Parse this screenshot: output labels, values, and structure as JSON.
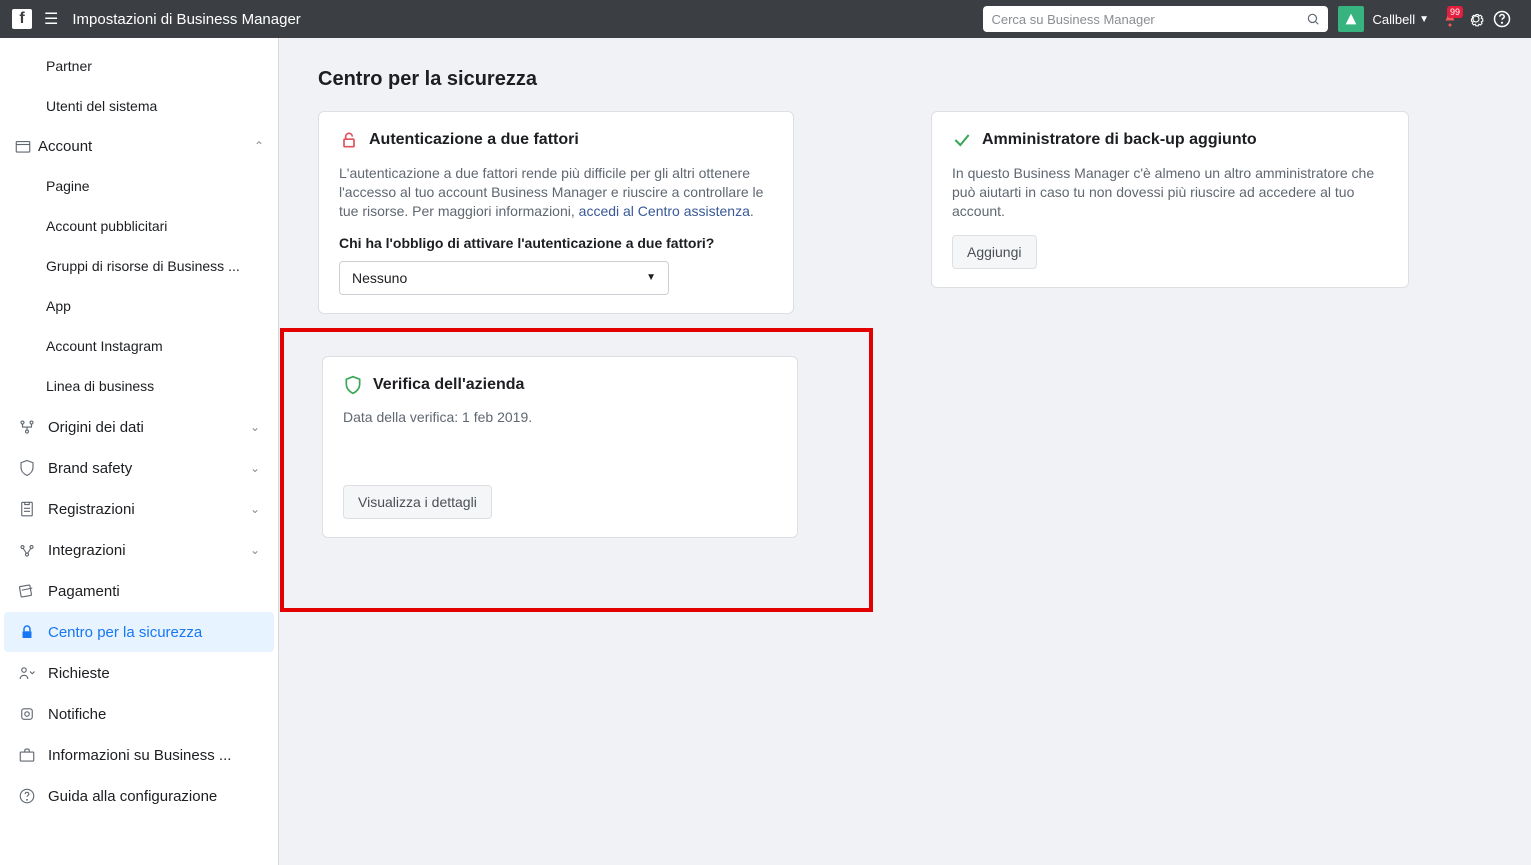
{
  "header": {
    "title": "Impostazioni di Business Manager",
    "search_placeholder": "Cerca su Business Manager",
    "brand_name": "Callbell",
    "notif_count": "99"
  },
  "sidebar": {
    "partner": "Partner",
    "utenti_sistema": "Utenti del sistema",
    "account_group": "Account",
    "pagine": "Pagine",
    "account_pubblicitari": "Account pubblicitari",
    "gruppi_risorse": "Gruppi di risorse di Business ...",
    "app": "App",
    "account_instagram": "Account Instagram",
    "linea_business": "Linea di business",
    "origini_dati": "Origini dei dati",
    "brand_safety": "Brand safety",
    "registrazioni": "Registrazioni",
    "integrazioni": "Integrazioni",
    "pagamenti": "Pagamenti",
    "centro_sicurezza": "Centro per la sicurezza",
    "richieste": "Richieste",
    "notifiche": "Notifiche",
    "informazioni_business": "Informazioni su Business ...",
    "guida_config": "Guida alla configurazione"
  },
  "main": {
    "page_title": "Centro per la sicurezza",
    "auth": {
      "title": "Autenticazione a due fattori",
      "desc_1": "L'autenticazione a due fattori rende più difficile per gli altri ottenere l'accesso al tuo account Business Manager e riuscire a controllare le tue risorse. Per maggiori informazioni, ",
      "link": "accedi al Centro assistenza",
      "question": "Chi ha l'obbligo di attivare l'autenticazione a due fattori?",
      "selected": "Nessuno"
    },
    "admin": {
      "title": "Amministratore di back-up aggiunto",
      "desc": "In questo Business Manager c'è almeno un altro amministratore che può aiutarti in caso tu non dovessi più riuscire ad accedere al tuo account.",
      "button": "Aggiungi"
    },
    "verify": {
      "title": "Verifica dell'azienda",
      "date": "Data della verifica: 1 feb 2019.",
      "button": "Visualizza i dettagli"
    }
  }
}
